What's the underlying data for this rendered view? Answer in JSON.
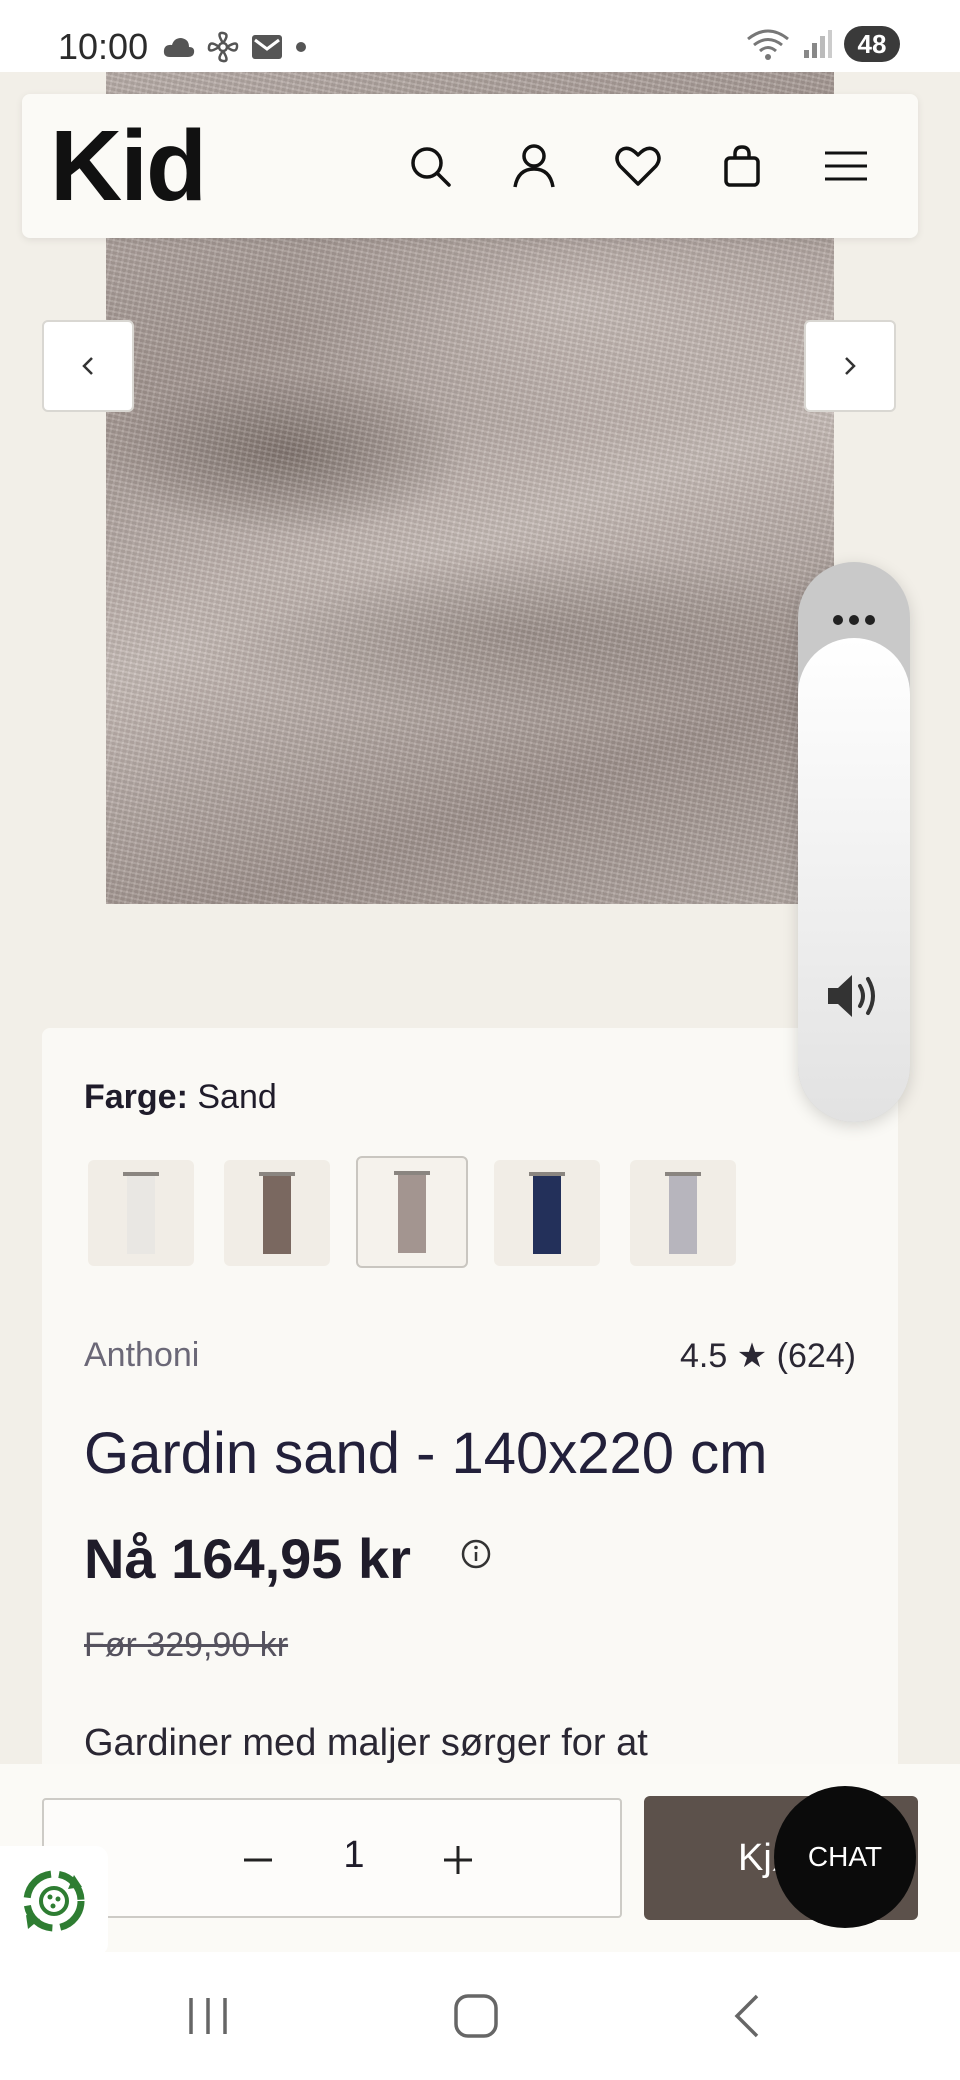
{
  "status_bar": {
    "time": "10:00",
    "battery": "48",
    "left_icons": [
      "cloud-icon",
      "fan-icon",
      "mail-icon",
      "dot-icon"
    ],
    "right_icons": [
      "wifi-icon",
      "signal-icon"
    ]
  },
  "header": {
    "logo": "Kid",
    "icons": [
      "search-icon",
      "account-icon",
      "heart-icon",
      "bag-icon",
      "menu-icon"
    ]
  },
  "gallery": {
    "prev_label": "‹",
    "next_label": "›"
  },
  "volume_panel": {
    "more_icon": "more-icon",
    "speaker_icon": "speaker-icon"
  },
  "product": {
    "color_label": "Farge:",
    "color_value": "Sand",
    "swatches": [
      {
        "name": "white",
        "color": "#e9e7e3",
        "selected": false
      },
      {
        "name": "brown",
        "color": "#7a6860",
        "selected": false
      },
      {
        "name": "sand",
        "color": "#a39590",
        "selected": true
      },
      {
        "name": "navy",
        "color": "#23305a",
        "selected": false
      },
      {
        "name": "grey",
        "color": "#b7b5bd",
        "selected": false
      }
    ],
    "brand": "Anthoni",
    "rating": "4.5 ★ (624)",
    "title": "Gardin sand - 140x220 cm",
    "price_prefix": "Nå",
    "price": "164,95 kr",
    "old_price": "Før 329,90 kr",
    "description": "Gardiner med maljer sørger for at"
  },
  "buy_bar": {
    "qty_minus": "–",
    "quantity": "1",
    "qty_plus": "+",
    "buy_label": "Kjøp",
    "chat_label": "CHAT"
  },
  "nav_bar": {
    "icons": [
      "recent-apps-icon",
      "home-icon",
      "back-icon"
    ]
  },
  "colors": {
    "page_bg": "#f2efe8",
    "card_bg": "#faf9f5",
    "buy_button": "#5c514b",
    "chat_button": "#0b0b0b",
    "eco_green": "#2e7d32"
  }
}
